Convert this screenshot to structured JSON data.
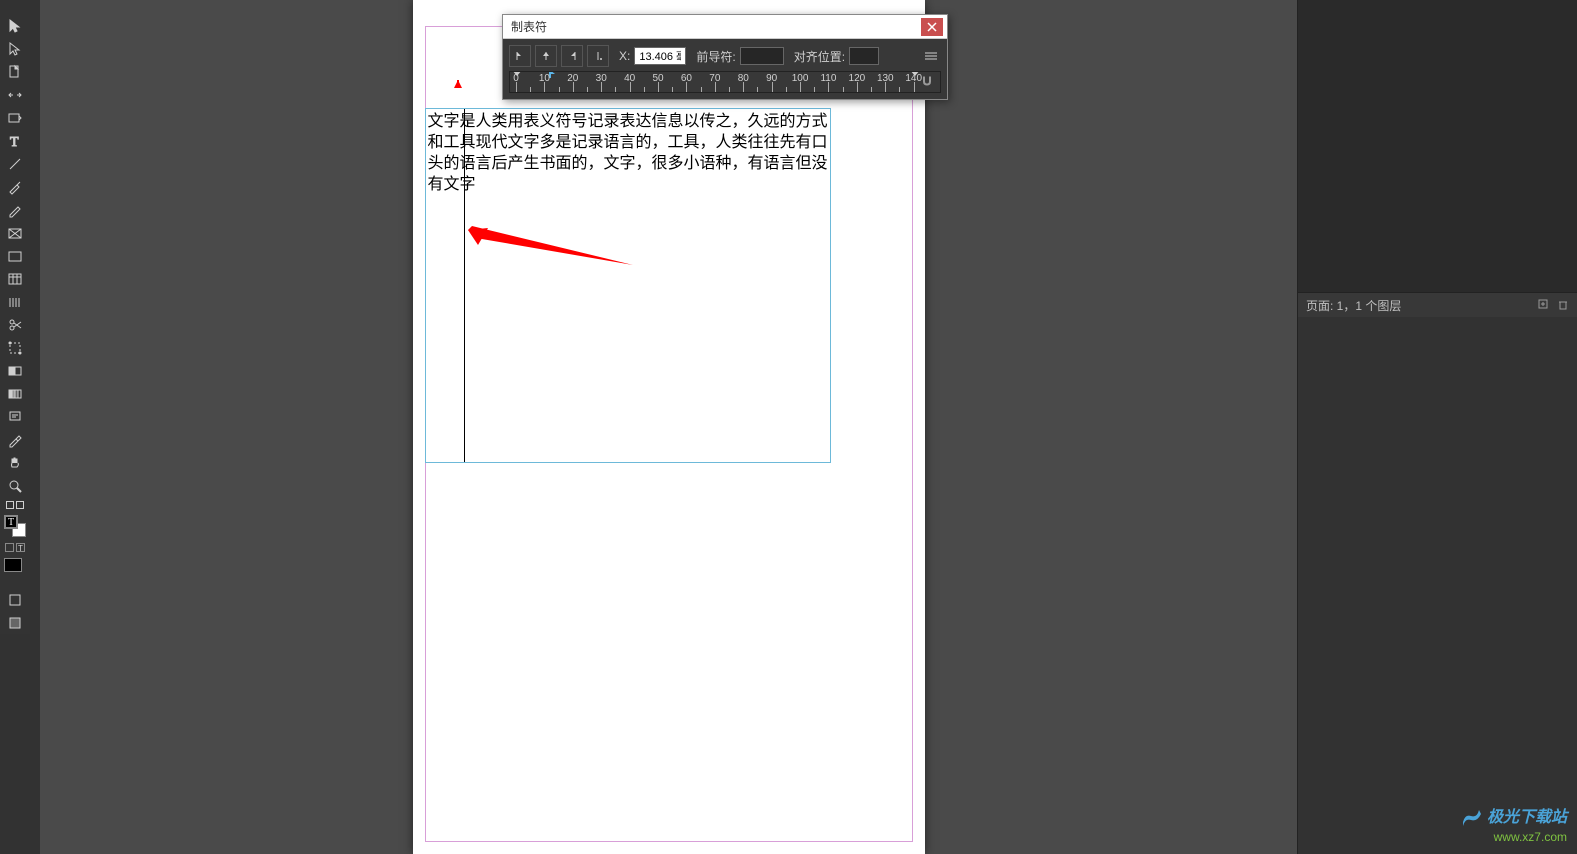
{
  "dialog": {
    "title": "制表符",
    "x_label": "X:",
    "x_value": "13.406 毫",
    "leader_label": "前导符:",
    "leader_value": "",
    "align_label": "对齐位置:",
    "align_value": "",
    "ruler_ticks": [
      "0",
      "10",
      "20",
      "30",
      "40",
      "50",
      "60",
      "70",
      "80",
      "90",
      "100",
      "110",
      "120",
      "130",
      "140"
    ]
  },
  "document": {
    "text": "文字是人类用表义符号记录表达信息以传之，久远的方式和工具现代文字多是记录语言的，工具，人类往往先有口头的语言后产生书面的，文字，很多小语种，有语言但没有文字"
  },
  "right_panel": {
    "status": "页面: 1，1 个图层"
  },
  "watermark": {
    "logo_main": "极光下载站",
    "url": "www.xz7.com"
  }
}
